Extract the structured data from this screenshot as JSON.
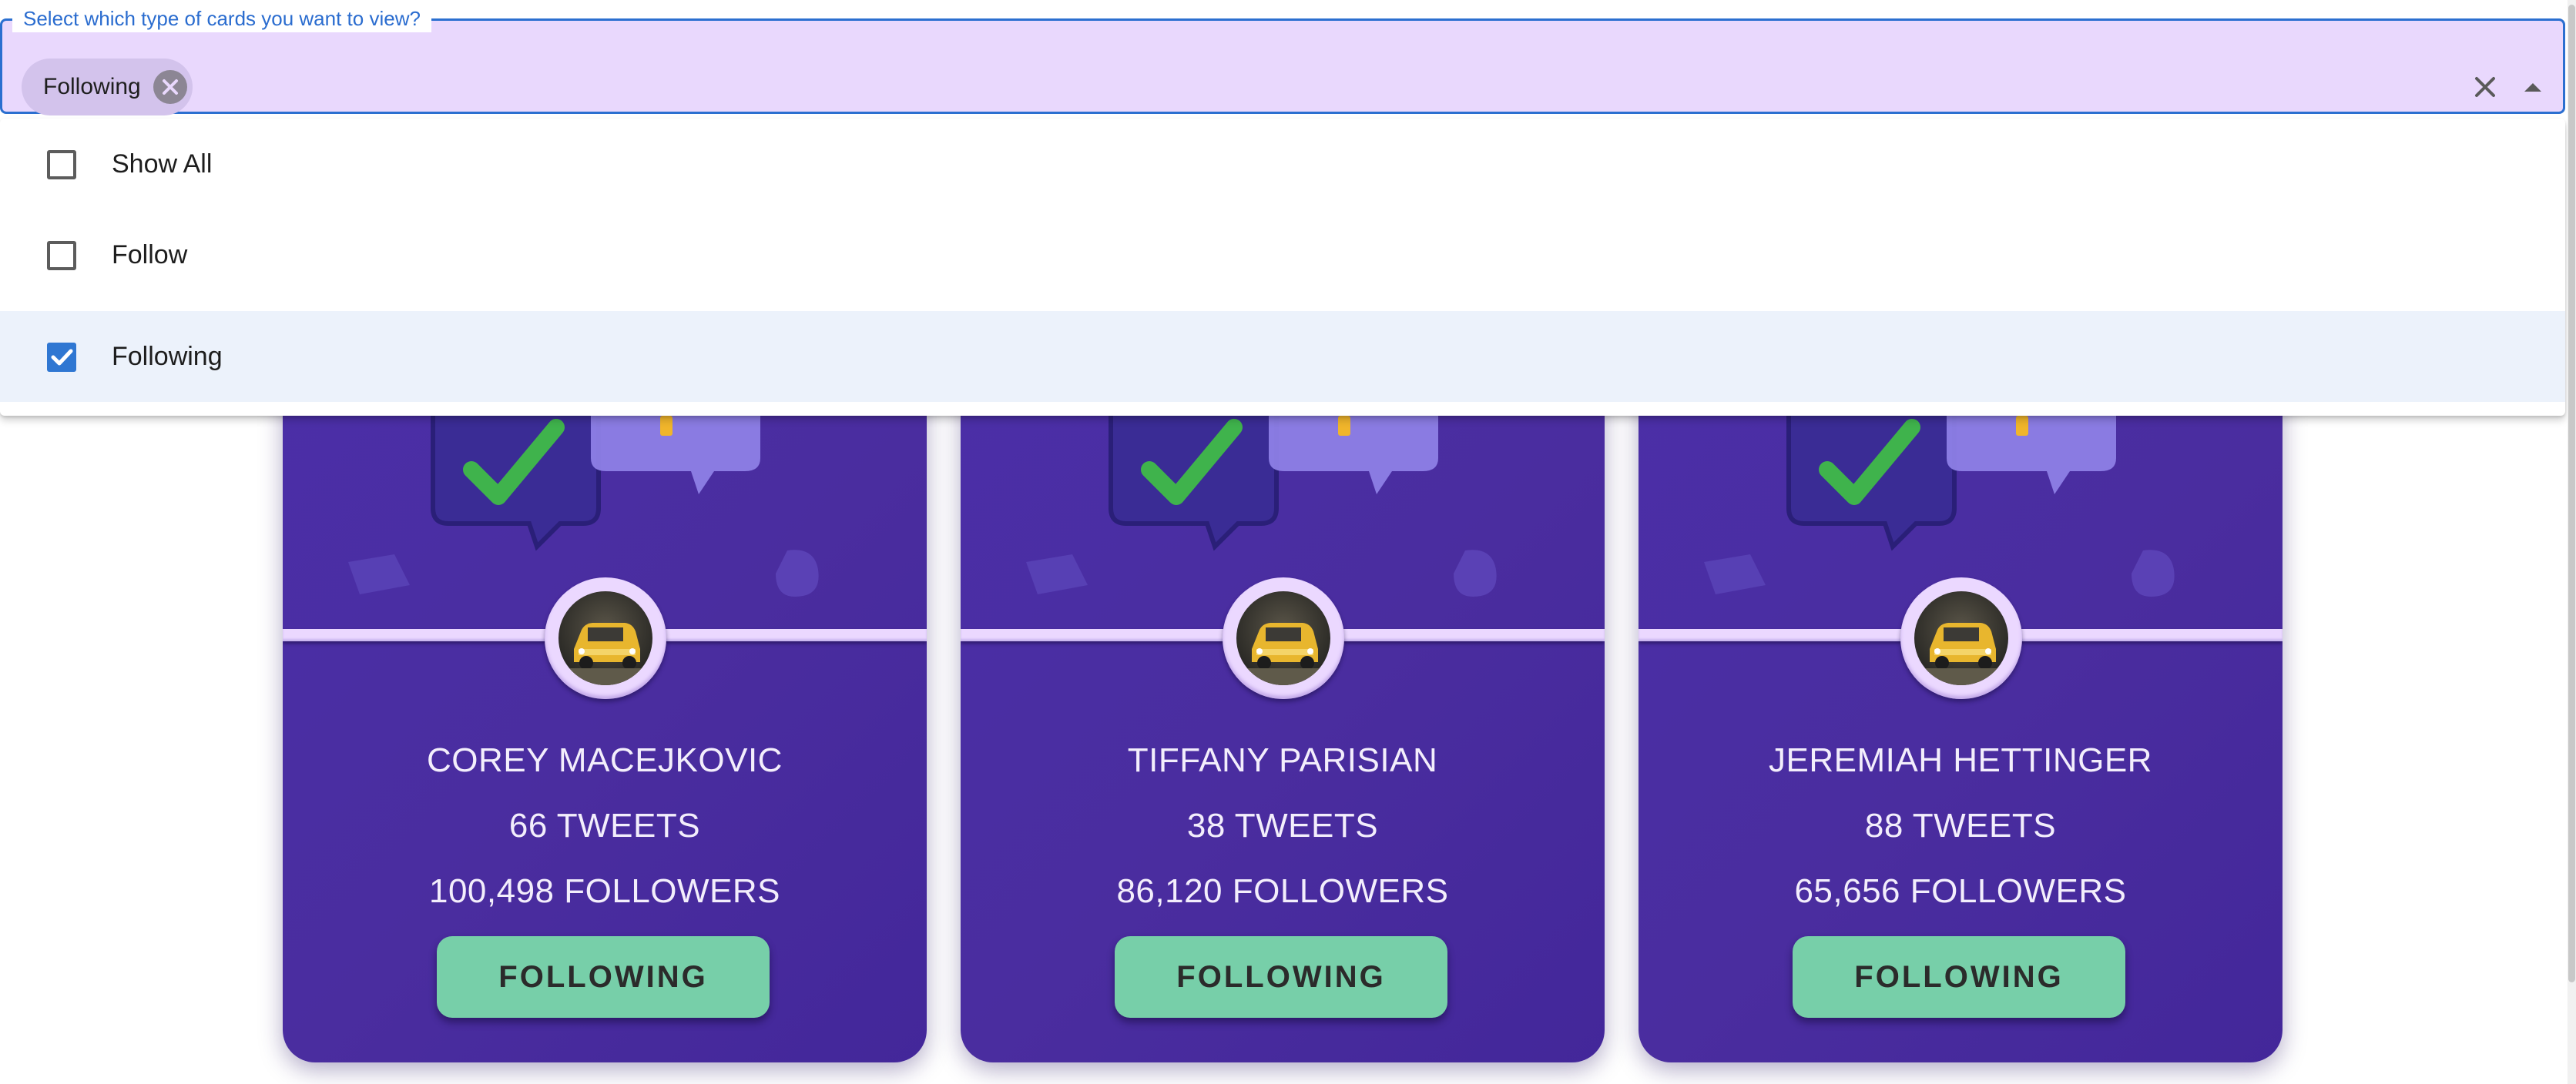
{
  "select": {
    "legend": "Select which type of cards you want to view?",
    "selected_chip": "Following",
    "options": [
      {
        "label": "Show All",
        "checked": false
      },
      {
        "label": "Follow",
        "checked": false
      },
      {
        "label": "Following",
        "checked": true
      }
    ]
  },
  "cards": [
    {
      "name": "COREY MACEJKOVIC",
      "tweets": "66 TWEETS",
      "followers": "100,498 FOLLOWERS",
      "button_label": "FOLLOWING"
    },
    {
      "name": "TIFFANY PARISIAN",
      "tweets": "38 TWEETS",
      "followers": "86,120 FOLLOWERS",
      "button_label": "FOLLOWING"
    },
    {
      "name": "JEREMIAH HETTINGER",
      "tweets": "88 TWEETS",
      "followers": "65,656 FOLLOWERS",
      "button_label": "FOLLOWING"
    }
  ],
  "icons": {
    "chip_delete": "cancel-circle-icon",
    "clear": "close-icon",
    "dropdown": "arrow-drop-up-icon",
    "checkbox_checked": "checkbox-checked-icon",
    "checkbox_empty": "checkbox-empty-icon"
  },
  "colors": {
    "card_background": "#4a2d9f",
    "button_background": "#77cfa9",
    "select_background": "#e9d8fd",
    "accent_blue": "#2f77d2"
  }
}
